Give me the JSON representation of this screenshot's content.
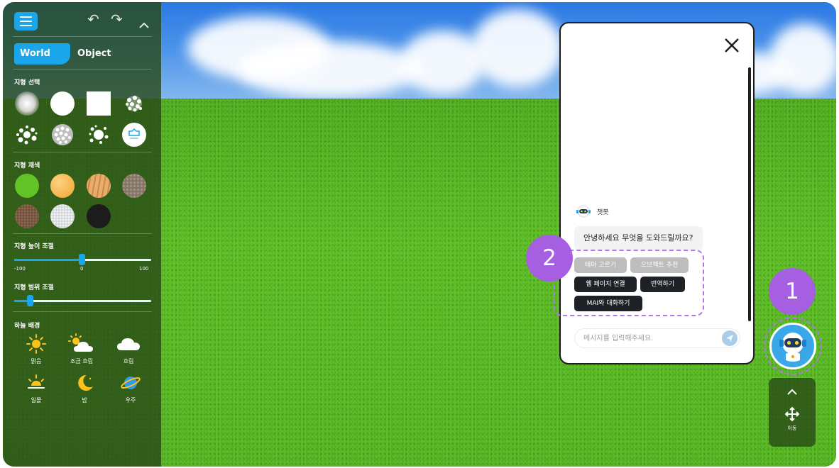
{
  "world_panel": {
    "tabs": [
      {
        "label": "World",
        "active": true
      },
      {
        "label": "Object",
        "active": false
      }
    ],
    "sections": {
      "terrain_select": "지형 선택",
      "terrain_material": "지형 재색",
      "terrain_height": "지형 높이 조절",
      "terrain_range": "지형 범위 조절",
      "sky_background": "하늘 배경"
    },
    "terrain_brushes": [
      "soft-brush-icon",
      "circle-brush-icon",
      "square-brush-icon",
      "noise-brush-icon",
      "splatter-brush-icon",
      "dots-brush-icon",
      "scatter-brush-icon",
      "upload-brush-icon"
    ],
    "material_colors": [
      "#62c327",
      "#f5b345",
      "#e2a15e",
      "#9a8a7a",
      "#7a5a45",
      "#d9dde0",
      "#1c1c1c"
    ],
    "height_slider": {
      "min": "-100",
      "mid": "0",
      "max": "100",
      "value": 0
    },
    "range_slider": {
      "value": 0.12
    },
    "sky_options": [
      {
        "label": "맑음",
        "icon": "sun-icon"
      },
      {
        "label": "조금 흐림",
        "icon": "partly-cloudy-icon"
      },
      {
        "label": "흐림",
        "icon": "cloud-icon"
      },
      {
        "label": "일몰",
        "icon": "sunset-icon"
      },
      {
        "label": "밤",
        "icon": "moon-icon"
      },
      {
        "label": "우주",
        "icon": "planet-icon"
      }
    ]
  },
  "chat": {
    "bot_name": "챗봇",
    "greeting": "안녕하세요 무엇을 도와드릴까요?",
    "suggestions": [
      {
        "label": "테마 고르기",
        "state": "disabled"
      },
      {
        "label": "오브젝트 추천",
        "state": "disabled"
      },
      {
        "label": "웹 페이지 연결",
        "state": "active"
      },
      {
        "label": "번역하기",
        "state": "active"
      },
      {
        "label": "MAI와 대화하기",
        "state": "active"
      }
    ],
    "input_placeholder": "메시지를 입력해주세요."
  },
  "callouts": {
    "chat_bot": "1",
    "suggestions": "2"
  },
  "move_control": {
    "label": "이동"
  },
  "accent_color": "#1aa6e8",
  "callout_color": "#a55fe0"
}
